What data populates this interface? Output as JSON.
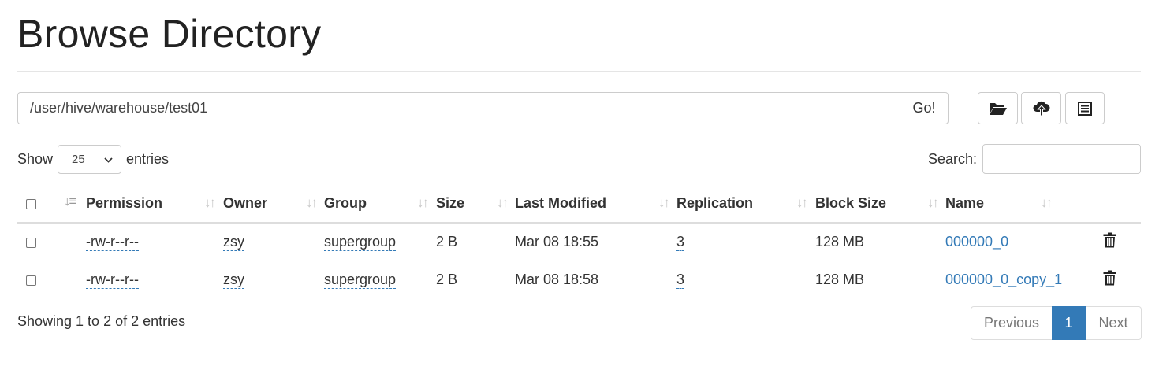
{
  "page": {
    "title": "Browse Directory"
  },
  "path_bar": {
    "value": "/user/hive/warehouse/test01",
    "go_label": "Go!"
  },
  "toolbar": {
    "icons": [
      "folder-open-icon",
      "cloud-upload-icon",
      "list-alt-icon"
    ]
  },
  "length": {
    "show_label": "Show",
    "value": "25",
    "entries_label": "entries"
  },
  "search": {
    "label": "Search:",
    "value": ""
  },
  "table": {
    "columns": [
      "Permission",
      "Owner",
      "Group",
      "Size",
      "Last Modified",
      "Replication",
      "Block Size",
      "Name"
    ],
    "rows": [
      {
        "permission": "-rw-r--r--",
        "owner": "zsy",
        "group": "supergroup",
        "size": "2 B",
        "modified": "Mar 08 18:55",
        "replication": "3",
        "block_size": "128 MB",
        "name": "000000_0"
      },
      {
        "permission": "-rw-r--r--",
        "owner": "zsy",
        "group": "supergroup",
        "size": "2 B",
        "modified": "Mar 08 18:58",
        "replication": "3",
        "block_size": "128 MB",
        "name": "000000_0_copy_1"
      }
    ]
  },
  "footer": {
    "info": "Showing 1 to 2 of 2 entries",
    "previous": "Previous",
    "current_page": "1",
    "next": "Next"
  },
  "colors": {
    "link": "#337ab7",
    "active_page": "#337ab7"
  }
}
